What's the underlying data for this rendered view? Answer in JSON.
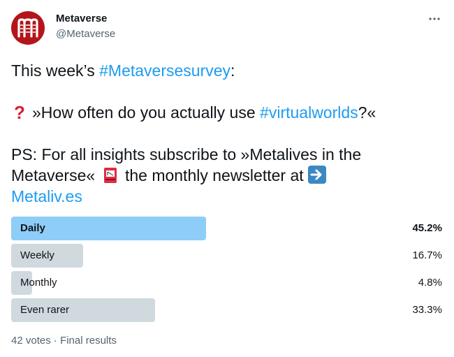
{
  "author": {
    "name": "Metaverse",
    "handle": "@Metaverse",
    "avatar_color": "#b3151b"
  },
  "tweet": {
    "line1_prefix": "This week’s ",
    "line1_hashtag": "#Metaversesurvey",
    "line1_suffix": ":",
    "line2_prefix": "»How often do you actually use ",
    "line2_hashtag": "#virtualworlds",
    "line2_suffix": "?«",
    "line3": "PS: For all insights subscribe to »Metalives in the",
    "line4_prefix": "Metaverse«",
    "line4_suffix": "the monthly newsletter at",
    "link": "Metaliv.es",
    "link_color": "#1d9bf0"
  },
  "poll": {
    "options": [
      {
        "label": "Daily",
        "percent_text": "45.2%",
        "percent": 45.2,
        "winner": true
      },
      {
        "label": "Weekly",
        "percent_text": "16.7%",
        "percent": 16.7,
        "winner": false
      },
      {
        "label": "Monthly",
        "percent_text": "4.8%",
        "percent": 4.8,
        "winner": false
      },
      {
        "label": "Even rarer",
        "percent_text": "33.3%",
        "percent": 33.3,
        "winner": false
      }
    ],
    "votes": "42 votes",
    "separator": "·",
    "status": "Final results",
    "winner_color": "#8ecdf8",
    "bar_color": "#cfd9de"
  }
}
